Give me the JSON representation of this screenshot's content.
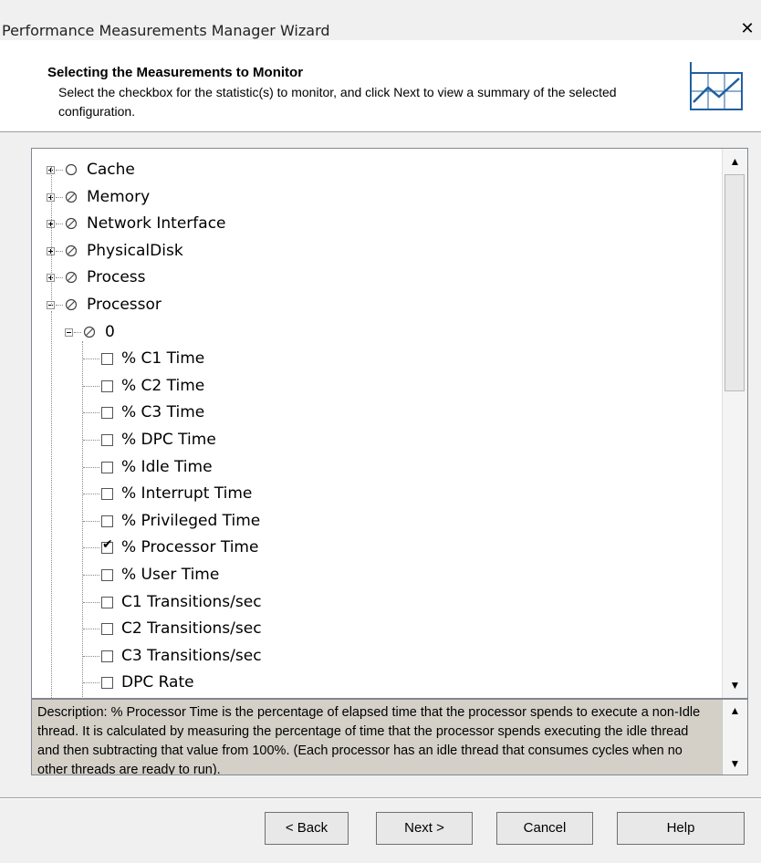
{
  "window": {
    "title": "Performance Measurements Manager Wizard",
    "close_glyph": "✕"
  },
  "header": {
    "title": "Selecting the Measurements to Monitor",
    "subtitle": "Select the checkbox for the statistic(s) to monitor, and click Next to view a summary of the selected configuration.",
    "icon": "chart-icon"
  },
  "tree": {
    "top_nodes": [
      {
        "label": "Cache",
        "state": "empty",
        "expanded": false
      },
      {
        "label": "Memory",
        "state": "partial",
        "expanded": false
      },
      {
        "label": "Network Interface",
        "state": "partial",
        "expanded": false
      },
      {
        "label": "PhysicalDisk",
        "state": "partial",
        "expanded": false
      },
      {
        "label": "Process",
        "state": "partial",
        "expanded": false
      },
      {
        "label": "Processor",
        "state": "partial",
        "expanded": true
      }
    ],
    "instance": {
      "label": "0",
      "state": "partial",
      "expanded": true
    },
    "counters": [
      {
        "label": "% C1 Time",
        "checked": false
      },
      {
        "label": "% C2 Time",
        "checked": false
      },
      {
        "label": "% C3 Time",
        "checked": false
      },
      {
        "label": "% DPC Time",
        "checked": false
      },
      {
        "label": "% Idle Time",
        "checked": false
      },
      {
        "label": "% Interrupt Time",
        "checked": false
      },
      {
        "label": "% Privileged Time",
        "checked": false
      },
      {
        "label": "% Processor Time",
        "checked": true
      },
      {
        "label": "% User Time",
        "checked": false
      },
      {
        "label": "C1 Transitions/sec",
        "checked": false
      },
      {
        "label": "C2 Transitions/sec",
        "checked": false
      },
      {
        "label": "C3 Transitions/sec",
        "checked": false
      },
      {
        "label": "DPC Rate",
        "checked": false
      }
    ]
  },
  "description": {
    "text": "Description: % Processor Time is the percentage of elapsed time that the processor spends to execute a non-Idle thread. It is calculated by measuring the percentage of time that the processor spends executing the idle thread and then subtracting that value from 100%. (Each processor has an idle thread that consumes cycles when no other threads are ready to run)."
  },
  "buttons": {
    "back": "< Back",
    "next": "Next >",
    "cancel": "Cancel",
    "help": "Help"
  },
  "scroll_arrows": {
    "up": "▲",
    "down": "▼"
  },
  "colors": {
    "dialog_bg": "#f0f0f0",
    "header_bg": "#ffffff",
    "description_bg": "#d4d0c8"
  }
}
